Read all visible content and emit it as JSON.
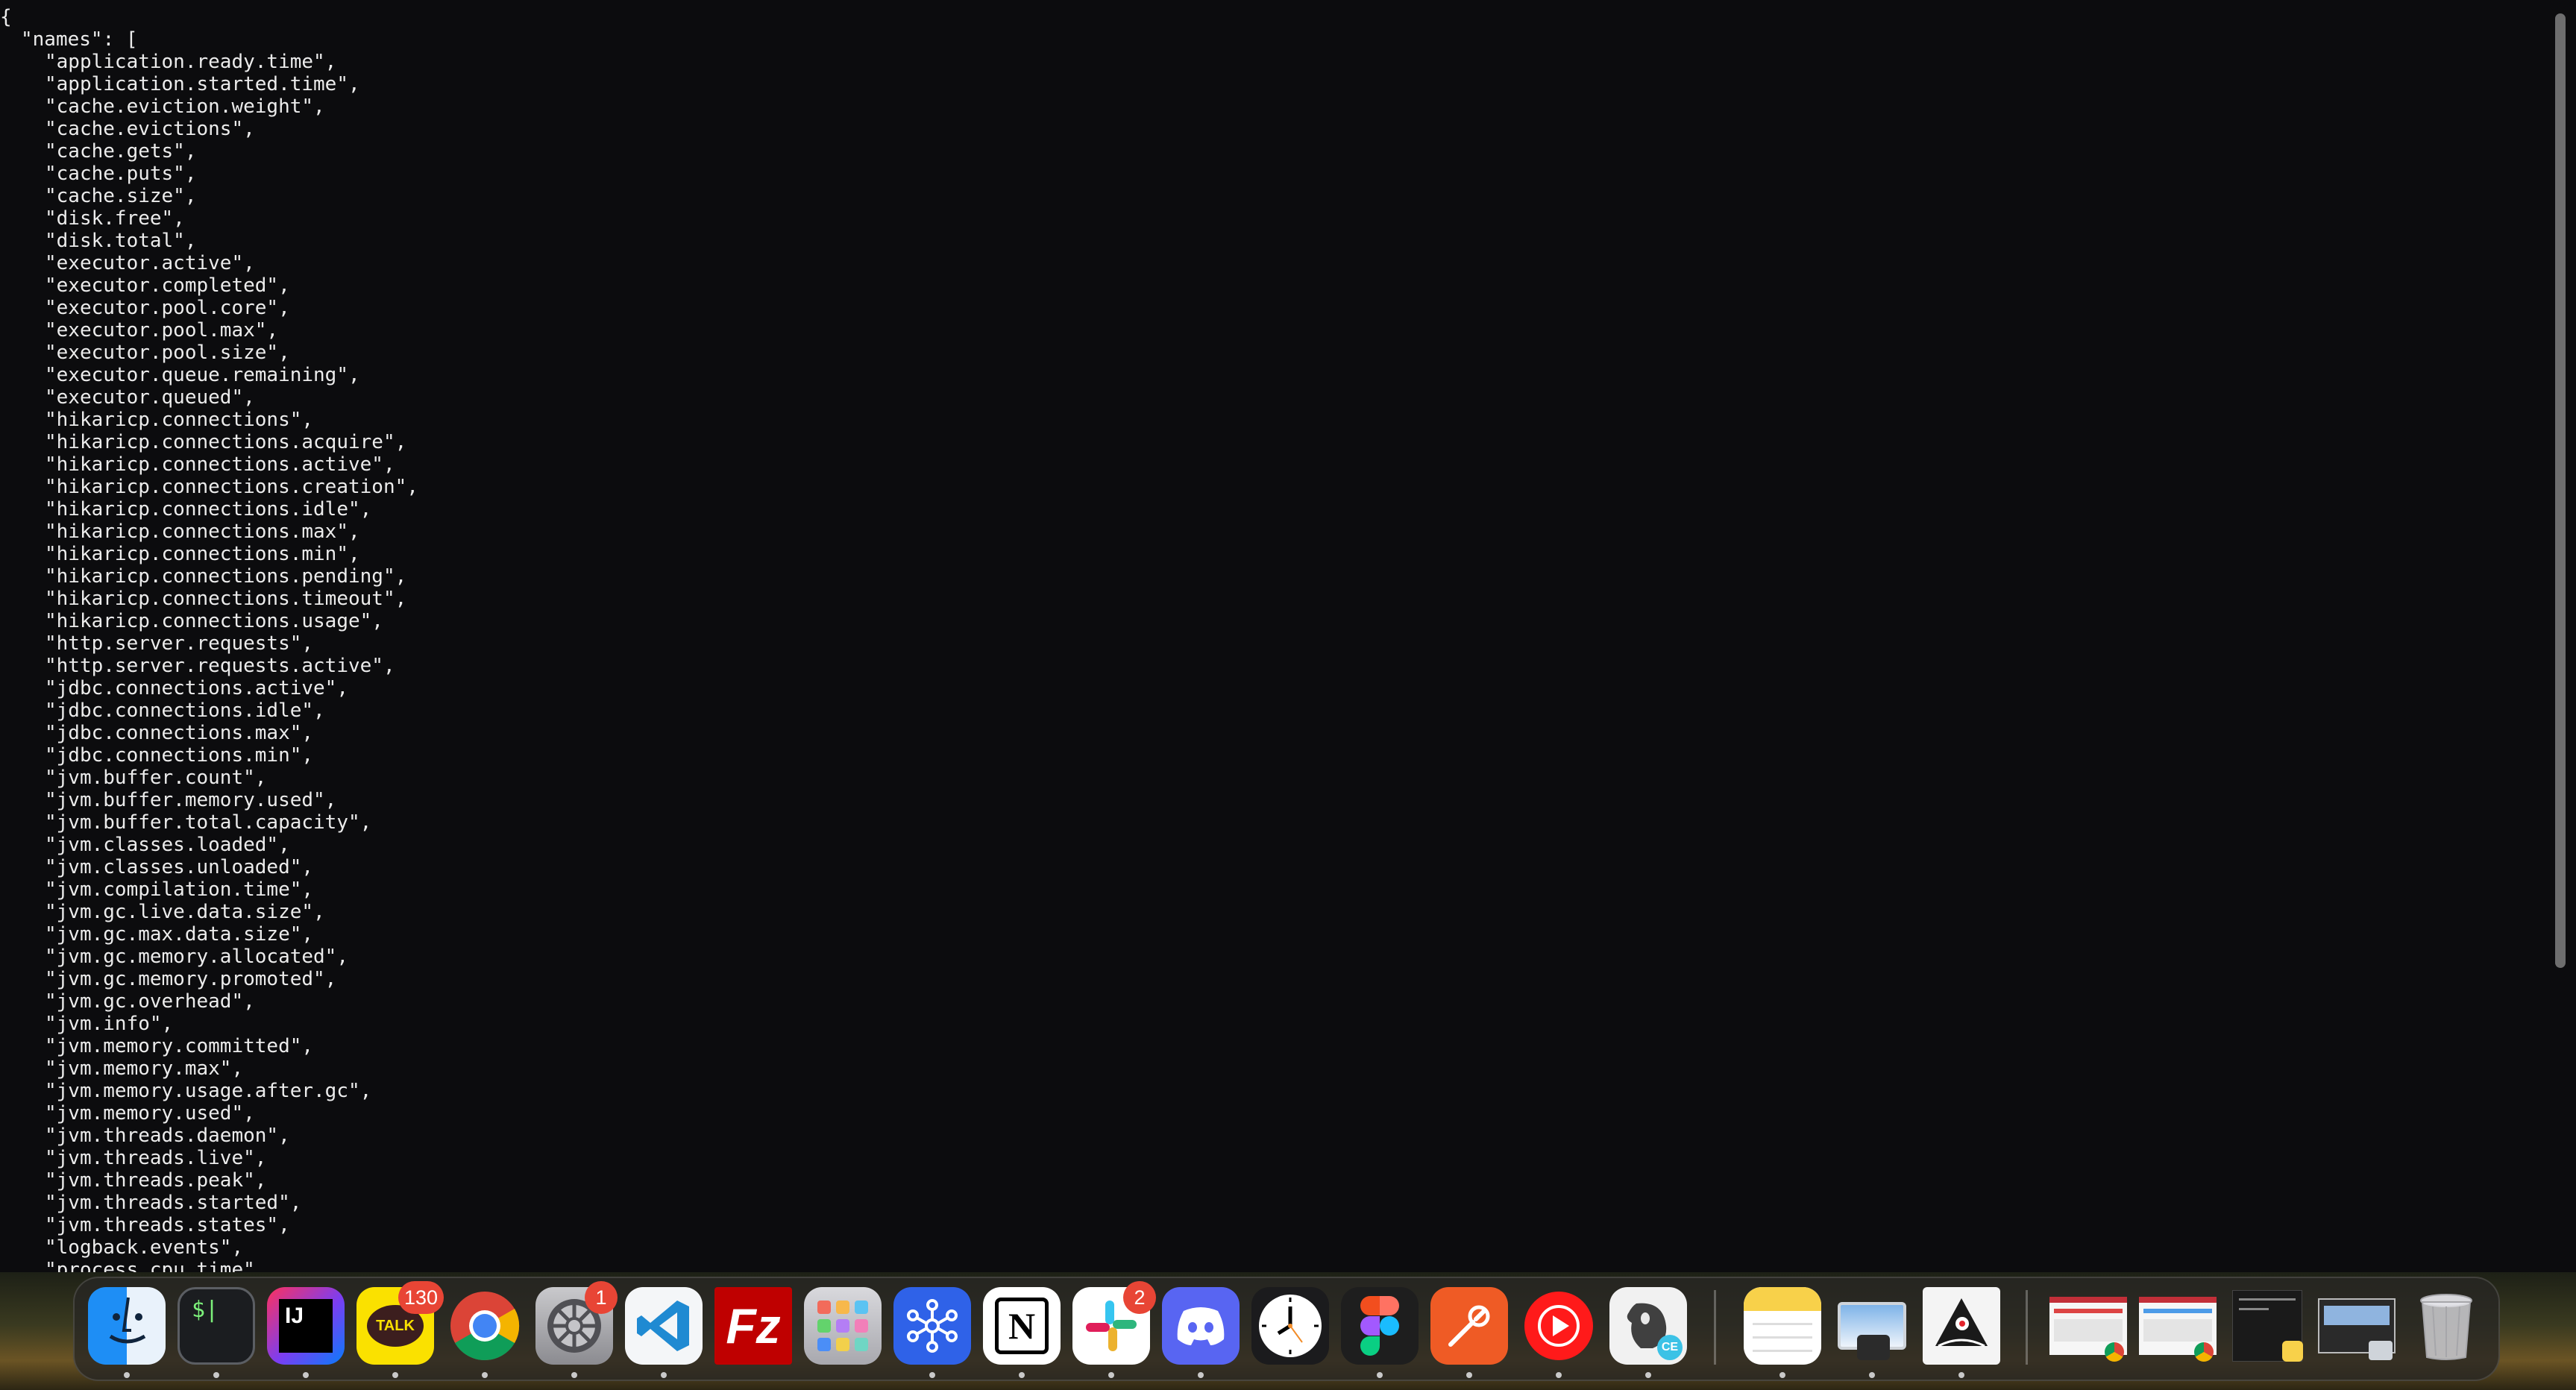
{
  "json_viewer": {
    "lines": [
      "{",
      "\"names\": [",
      "\"application.ready.time\",",
      "\"application.started.time\",",
      "\"cache.eviction.weight\",",
      "\"cache.evictions\",",
      "\"cache.gets\",",
      "\"cache.puts\",",
      "\"cache.size\",",
      "\"disk.free\",",
      "\"disk.total\",",
      "\"executor.active\",",
      "\"executor.completed\",",
      "\"executor.pool.core\",",
      "\"executor.pool.max\",",
      "\"executor.pool.size\",",
      "\"executor.queue.remaining\",",
      "\"executor.queued\",",
      "\"hikaricp.connections\",",
      "\"hikaricp.connections.acquire\",",
      "\"hikaricp.connections.active\",",
      "\"hikaricp.connections.creation\",",
      "\"hikaricp.connections.idle\",",
      "\"hikaricp.connections.max\",",
      "\"hikaricp.connections.min\",",
      "\"hikaricp.connections.pending\",",
      "\"hikaricp.connections.timeout\",",
      "\"hikaricp.connections.usage\",",
      "\"http.server.requests\",",
      "\"http.server.requests.active\",",
      "\"jdbc.connections.active\",",
      "\"jdbc.connections.idle\",",
      "\"jdbc.connections.max\",",
      "\"jdbc.connections.min\",",
      "\"jvm.buffer.count\",",
      "\"jvm.buffer.memory.used\",",
      "\"jvm.buffer.total.capacity\",",
      "\"jvm.classes.loaded\",",
      "\"jvm.classes.unloaded\",",
      "\"jvm.compilation.time\",",
      "\"jvm.gc.live.data.size\",",
      "\"jvm.gc.max.data.size\",",
      "\"jvm.gc.memory.allocated\",",
      "\"jvm.gc.memory.promoted\",",
      "\"jvm.gc.overhead\",",
      "\"jvm.info\",",
      "\"jvm.memory.committed\",",
      "\"jvm.memory.max\",",
      "\"jvm.memory.usage.after.gc\",",
      "\"jvm.memory.used\",",
      "\"jvm.threads.daemon\",",
      "\"jvm.threads.live\",",
      "\"jvm.threads.peak\",",
      "\"jvm.threads.started\",",
      "\"jvm.threads.states\",",
      "\"logback.events\",",
      "\"process.cpu.time\","
    ]
  },
  "dock": {
    "apps": [
      {
        "name": "Finder",
        "icon": "finder-icon"
      },
      {
        "name": "Terminal",
        "icon": "terminal-icon",
        "label": "$|"
      },
      {
        "name": "IntelliJ IDEA",
        "icon": "intellij-icon",
        "label": "IJ"
      },
      {
        "name": "KakaoTalk",
        "icon": "kakaotalk-icon",
        "label": "TALK",
        "badge": "130"
      },
      {
        "name": "Google Chrome",
        "icon": "chrome-icon"
      },
      {
        "name": "System Settings",
        "icon": "settings-icon",
        "badge": "1"
      },
      {
        "name": "Visual Studio Code",
        "icon": "vscode-icon"
      },
      {
        "name": "FileZilla",
        "icon": "filezilla-icon",
        "label": "Fz"
      },
      {
        "name": "Launchpad",
        "icon": "launchpad-icon"
      },
      {
        "name": "Mercury",
        "icon": "network-icon"
      },
      {
        "name": "Notion",
        "icon": "notion-icon",
        "label": "N"
      },
      {
        "name": "Slack",
        "icon": "slack-icon",
        "badge": "2"
      },
      {
        "name": "Discord",
        "icon": "discord-icon"
      },
      {
        "name": "Clock",
        "icon": "clock-icon"
      },
      {
        "name": "Figma",
        "icon": "figma-icon"
      },
      {
        "name": "Postman",
        "icon": "postman-icon"
      },
      {
        "name": "YouTube Music",
        "icon": "youtube-music-icon"
      },
      {
        "name": "IntelliJ CE",
        "icon": "intellij-ce-icon",
        "label": "CE"
      },
      {
        "name": "Notes",
        "icon": "notes-icon"
      },
      {
        "name": "Preview",
        "icon": "preview-icon"
      },
      {
        "name": "Java",
        "icon": "java-icon"
      },
      {
        "name": "Chrome window 1",
        "icon": "window-thumbnail-icon"
      },
      {
        "name": "Chrome window 2",
        "icon": "window-thumbnail-icon"
      },
      {
        "name": "Notes window",
        "icon": "window-thumbnail-icon"
      },
      {
        "name": "Preview window",
        "icon": "window-thumbnail-icon"
      },
      {
        "name": "Trash",
        "icon": "trash-icon"
      }
    ]
  },
  "colors": {
    "background": "#0c0c0e",
    "text": "#ececec",
    "badge": "#e84535"
  }
}
